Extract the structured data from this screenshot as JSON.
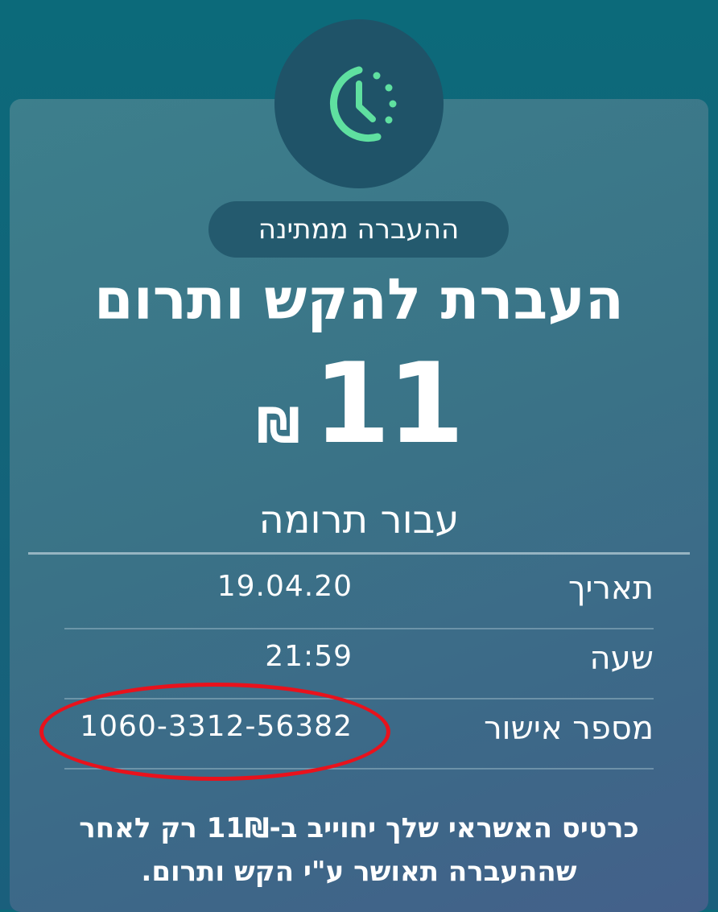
{
  "status": {
    "label": "ההעברה ממתינה",
    "icon": "clock-pending-icon"
  },
  "title": "העברת להקש ותרום",
  "amount": {
    "value": "11",
    "currency": "₪"
  },
  "purpose": "עבור תרומה",
  "details": [
    {
      "label": "תאריך",
      "value": "19.04.20"
    },
    {
      "label": "שעה",
      "value": "21:59"
    },
    {
      "label": "מספר אישור",
      "value": "1060-3312-56382"
    }
  ],
  "footer": {
    "line1": "כרטיס האשראי שלך יחוייב ב-11₪ רק לאחר",
    "line2": "שההעברה תאושר ע\"י הקש ותרום."
  },
  "colors": {
    "accent": "#5fe0a0",
    "highlight": "#e8121c"
  }
}
